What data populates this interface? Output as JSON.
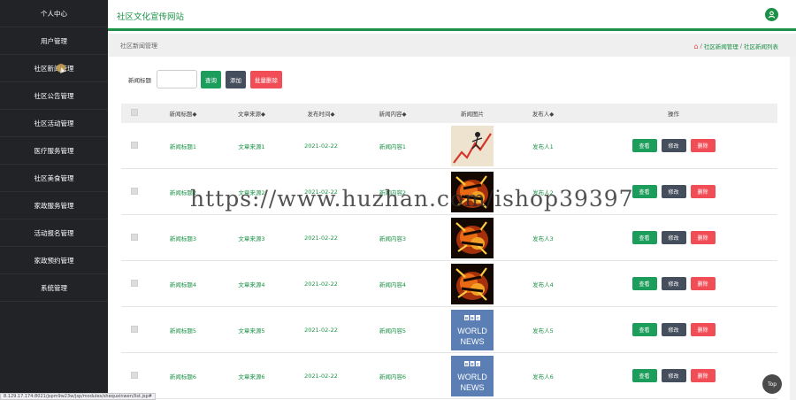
{
  "sidebar": {
    "items": [
      {
        "label": "个人中心"
      },
      {
        "label": "用户管理"
      },
      {
        "label": "社区新闻管理"
      },
      {
        "label": "社区公告管理"
      },
      {
        "label": "社区活动管理"
      },
      {
        "label": "医疗服务管理"
      },
      {
        "label": "社区美食管理"
      },
      {
        "label": "家政服务管理"
      },
      {
        "label": "活动报名管理"
      },
      {
        "label": "家政预约管理"
      },
      {
        "label": "系统管理"
      }
    ]
  },
  "header": {
    "title": "社区文化宣传网站",
    "user_icon": "user-icon"
  },
  "breadcrumb": {
    "page_title": "社区新闻管理",
    "sep": "/",
    "crumb1": "社区新闻管理",
    "crumb2": "社区新闻列表"
  },
  "search": {
    "label": "新闻标题",
    "value": "",
    "query_button": "查询",
    "add_button": "添加",
    "batch_delete_button": "批量删除"
  },
  "table": {
    "columns": [
      "新闻标题◆",
      "文章来源◆",
      "发布时间◆",
      "新闻内容◆",
      "新闻图片",
      "发布人◆",
      "操作"
    ],
    "rows": [
      {
        "title": "新闻标题1",
        "source": "文章来源1",
        "date": "2021-02-22",
        "content": "新闻内容1",
        "image": "graph-figure",
        "publisher": "发布人1"
      },
      {
        "title": "新闻标题2",
        "source": "文章来源2",
        "date": "2021-02-22",
        "content": "新闻内容2",
        "image": "fire-logo",
        "publisher": "发布人2"
      },
      {
        "title": "新闻标题3",
        "source": "文章来源3",
        "date": "2021-02-22",
        "content": "新闻内容3",
        "image": "fire-logo",
        "publisher": "发布人3"
      },
      {
        "title": "新闻标题4",
        "source": "文章来源4",
        "date": "2021-02-22",
        "content": "新闻内容4",
        "image": "fire-logo",
        "publisher": "发布人4"
      },
      {
        "title": "新闻标题5",
        "source": "文章来源5",
        "date": "2021-02-22",
        "content": "新闻内容5",
        "image": "bbc-world-news",
        "publisher": "发布人5"
      },
      {
        "title": "新闻标题6",
        "source": "文章来源6",
        "date": "2021-02-22",
        "content": "新闻内容6",
        "image": "bbc-world-news",
        "publisher": "发布人6"
      }
    ],
    "view_label": "查看",
    "edit_label": "修改",
    "delete_label": "删除"
  },
  "bbc": {
    "line1": "BBC",
    "line2": "WORLD",
    "line3": "NEWS"
  },
  "watermark": "https://www.huzhan.com/ishop39397",
  "status_url": "8.129.17.174:8021/jspm9w23w/jsp/modules/shequxinwen/list.jsp#",
  "top_button": "Top",
  "colors": {
    "accent": "#1a9146",
    "sidebar_bg": "#222327",
    "danger": "#f14d56",
    "dark_button": "#454e5d"
  }
}
